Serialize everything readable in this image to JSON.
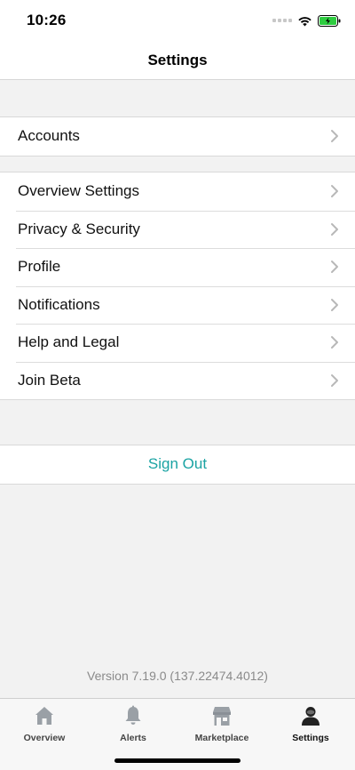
{
  "status_bar": {
    "time": "10:26"
  },
  "nav": {
    "title": "Settings"
  },
  "groups": {
    "accounts": {
      "label": "Accounts"
    },
    "main": [
      {
        "label": "Overview Settings"
      },
      {
        "label": "Privacy & Security"
      },
      {
        "label": "Profile"
      },
      {
        "label": "Notifications"
      },
      {
        "label": "Help and Legal"
      },
      {
        "label": "Join Beta"
      }
    ],
    "signout": {
      "label": "Sign Out"
    }
  },
  "version_text": "Version 7.19.0 (137.22474.4012)",
  "tabs": [
    {
      "label": "Overview",
      "icon": "home-icon"
    },
    {
      "label": "Alerts",
      "icon": "bell-icon"
    },
    {
      "label": "Marketplace",
      "icon": "store-icon"
    },
    {
      "label": "Settings",
      "icon": "person-icon",
      "active": true
    }
  ],
  "colors": {
    "accent": "#1aa3a3",
    "background": "#f2f2f2",
    "battery": "#2ecc40"
  }
}
